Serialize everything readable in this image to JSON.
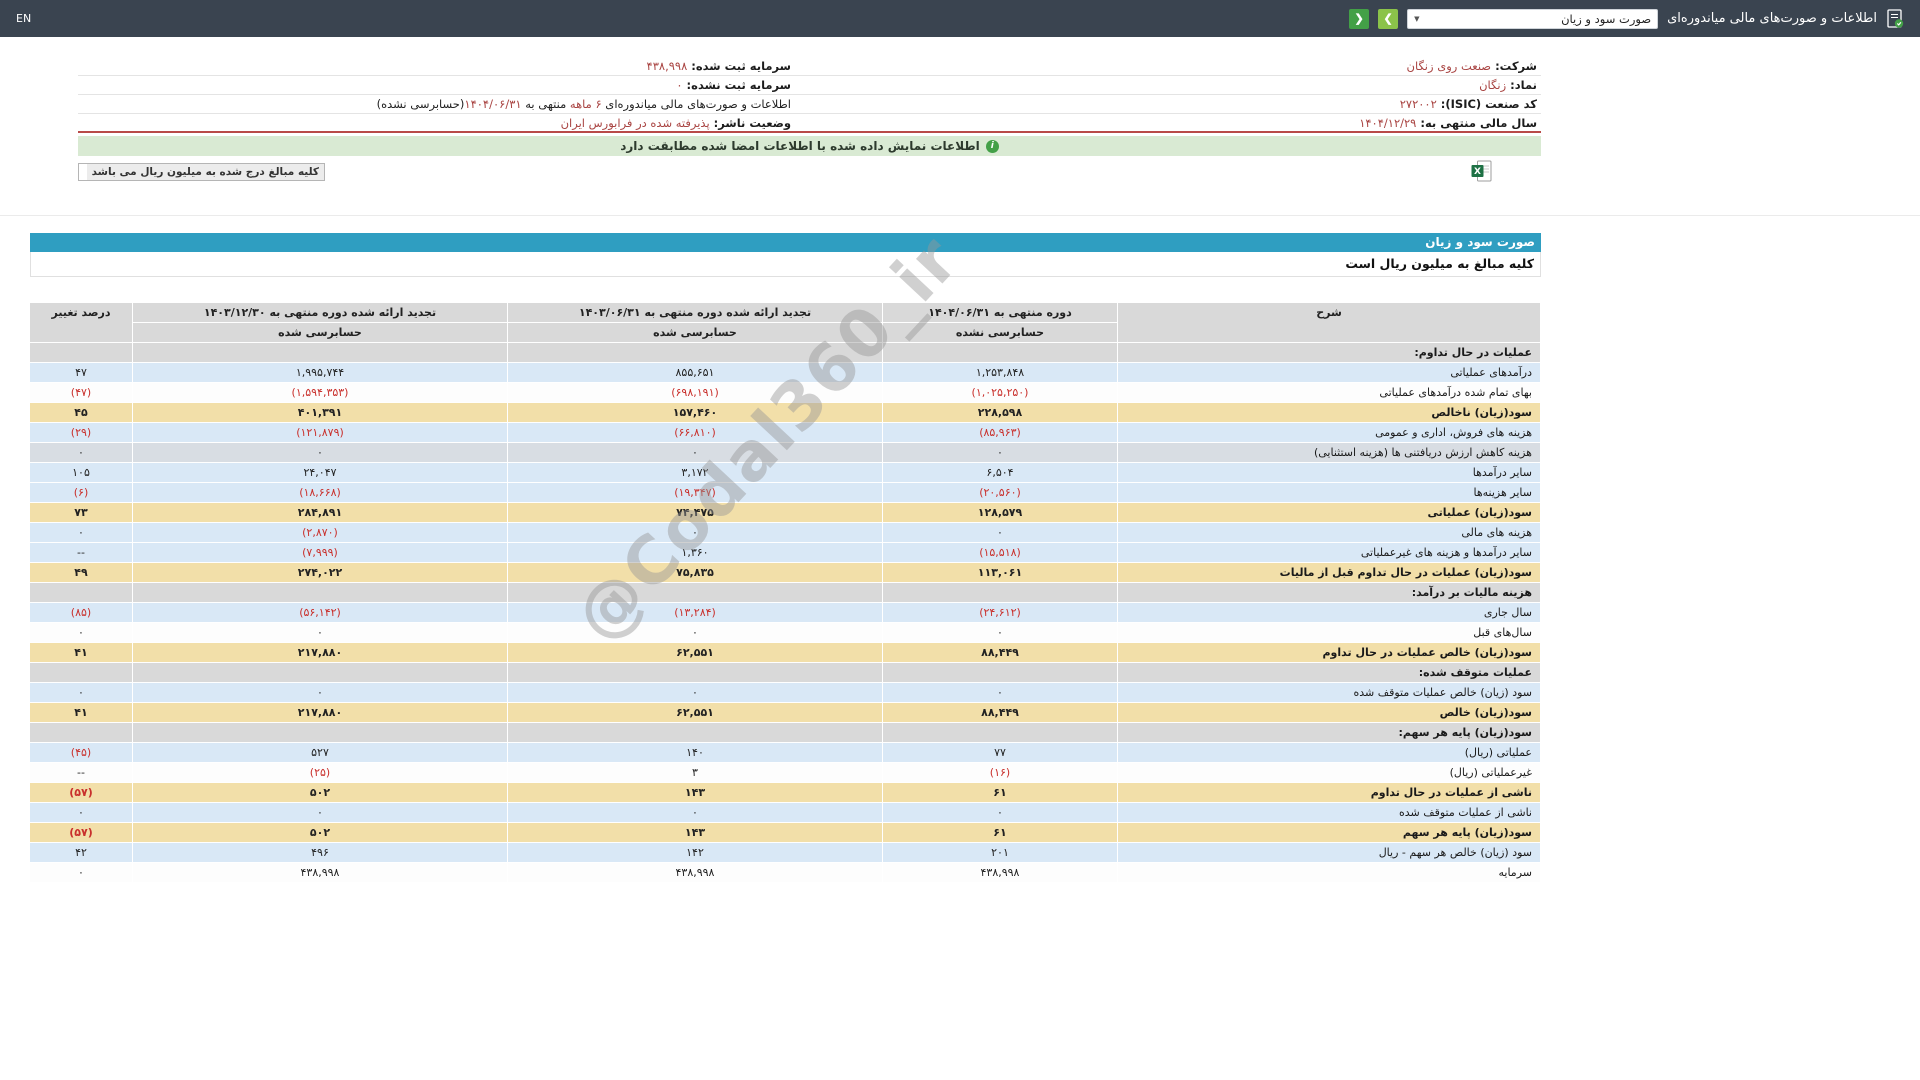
{
  "topbar": {
    "en_label": "EN",
    "title": "اطلاعات و صورت‌های مالی میاندوره‌ای",
    "report_select_value": "صورت سود و زیان"
  },
  "icons": {
    "chevron_down": "▼",
    "prev": "❮",
    "next": "❯"
  },
  "company": {
    "rows": [
      {
        "right": [
          {
            "t": "شرکت: ",
            "b": true
          },
          {
            "t": "صنعت روی زنگان",
            "red": true
          }
        ],
        "left": [
          {
            "t": "سرمایه ثبت شده: ",
            "b": true
          },
          {
            "t": "۴۳۸,۹۹۸",
            "red": true
          }
        ]
      },
      {
        "right": [
          {
            "t": "نماد: ",
            "b": true
          },
          {
            "t": "زنگان",
            "red": true
          }
        ],
        "left": [
          {
            "t": "سرمایه ثبت نشده: ",
            "b": true
          },
          {
            "t": "۰",
            "red": true
          }
        ]
      },
      {
        "right": [
          {
            "t": "کد صنعت (ISIC): ",
            "b": true
          },
          {
            "t": "۲۷۲۰۰۲",
            "red": true
          }
        ],
        "left": [
          {
            "t": "اطلاعات و صورت‌های مالی میاندوره‌ای "
          },
          {
            "t": "۶ ماهه",
            "red": true
          },
          {
            "t": " منتهی به "
          },
          {
            "t": "۱۴۰۴/۰۶/۳۱",
            "red": true
          },
          {
            "t": "(حسابرسی نشده)"
          }
        ]
      },
      {
        "right": [
          {
            "t": "سال مالی منتهی به: ",
            "b": true
          },
          {
            "t": "۱۴۰۴/۱۲/۲۹",
            "red": true
          }
        ],
        "left": [
          {
            "t": "وضعیت ناشر: ",
            "b": true
          },
          {
            "t": "پذیرفته شده در فرابورس ایران",
            "red": true
          }
        ]
      }
    ]
  },
  "banner": {
    "icon_glyph": "i",
    "text": "اطلاعات نمایش داده شده با اطلاعات امضا شده مطابقت دارد"
  },
  "note": {
    "text": "کلیه مبالغ درج شده به میلیون ریال می باشد"
  },
  "statement": {
    "title": "صورت سود و زیان",
    "unit_note": "کلیه مبالغ به میلیون ریال است",
    "columns": {
      "desc": "شرح",
      "col1": "دوره منتهی به ۱۴۰۴/۰۶/۳۱",
      "col1_sub": "حسابرسی نشده",
      "col2": "تجدید ارائه شده دوره منتهی به ۱۴۰۳/۰۶/۳۱",
      "col2_sub": "حسابرسی شده",
      "col3": "تجدید ارائه شده دوره منتهی به ۱۴۰۳/۱۲/۳۰",
      "col3_sub": "حسابرسی شده",
      "pct": "درصد تغییر"
    },
    "rows": [
      {
        "kind": "section",
        "label": "عملیات در حال تداوم:",
        "v1": "",
        "v2": "",
        "v3": "",
        "pct": ""
      },
      {
        "kind": "item",
        "label": "درآمدهای عملیاتی",
        "v1": "۱,۲۵۳,۸۴۸",
        "v2": "۸۵۵,۶۵۱",
        "v3": "۱,۹۹۵,۷۴۴",
        "pct": "۴۷"
      },
      {
        "kind": "item-alt",
        "label": "بهای تمام شده درآمدهای عملیاتی",
        "v1": "(۱,۰۲۵,۲۵۰)",
        "v2": "(۶۹۸,۱۹۱)",
        "v3": "(۱,۵۹۴,۳۵۳)",
        "pct": "(۴۷)"
      },
      {
        "kind": "total",
        "label": "سود(زیان) ناخالص",
        "v1": "۲۲۸,۵۹۸",
        "v2": "۱۵۷,۴۶۰",
        "v3": "۴۰۱,۳۹۱",
        "pct": "۴۵"
      },
      {
        "kind": "item",
        "label": "هزینه های فروش، اداری و عمومی",
        "v1": "(۸۵,۹۶۳)",
        "v2": "(۶۶,۸۱۰)",
        "v3": "(۱۲۱,۸۷۹)",
        "pct": "(۲۹)"
      },
      {
        "kind": "item-muted",
        "label": "هزینه کاهش ارزش دریافتنی ها (هزینه استثنایی)",
        "v1": "۰",
        "v2": "۰",
        "v3": "۰",
        "pct": "۰"
      },
      {
        "kind": "item",
        "label": "سایر درآمدها",
        "v1": "۶,۵۰۴",
        "v2": "۳,۱۷۲",
        "v3": "۲۴,۰۴۷",
        "pct": "۱۰۵"
      },
      {
        "kind": "item",
        "label": "سایر هزینه‌ها",
        "v1": "(۲۰,۵۶۰)",
        "v2": "(۱۹,۳۴۷)",
        "v3": "(۱۸,۶۶۸)",
        "pct": "(۶)"
      },
      {
        "kind": "total",
        "label": "سود(زیان) عملیاتی",
        "v1": "۱۲۸,۵۷۹",
        "v2": "۷۴,۴۷۵",
        "v3": "۲۸۴,۸۹۱",
        "pct": "۷۳"
      },
      {
        "kind": "item",
        "label": "هزینه های مالی",
        "v1": "۰",
        "v2": "۰",
        "v3": "(۲,۸۷۰)",
        "pct": "۰"
      },
      {
        "kind": "item",
        "label": "سایر درآمدها و هزینه های غیرعملیاتی",
        "v1": "(۱۵,۵۱۸)",
        "v2": "۱,۳۶۰",
        "v3": "(۷,۹۹۹)",
        "pct": "--"
      },
      {
        "kind": "total",
        "label": "سود(زیان) عملیات در حال تداوم قبل از مالیات",
        "v1": "۱۱۳,۰۶۱",
        "v2": "۷۵,۸۳۵",
        "v3": "۲۷۴,۰۲۲",
        "pct": "۴۹"
      },
      {
        "kind": "section",
        "label": "هزینه مالیات بر درآمد:",
        "v1": "",
        "v2": "",
        "v3": "",
        "pct": ""
      },
      {
        "kind": "item",
        "label": "سال جاری",
        "v1": "(۲۴,۶۱۲)",
        "v2": "(۱۳,۲۸۴)",
        "v3": "(۵۶,۱۴۲)",
        "pct": "(۸۵)"
      },
      {
        "kind": "item-alt",
        "label": "سال‌های قبل",
        "v1": "۰",
        "v2": "۰",
        "v3": "۰",
        "pct": "۰"
      },
      {
        "kind": "total",
        "label": "سود(زیان) خالص عملیات در حال تداوم",
        "v1": "۸۸,۴۴۹",
        "v2": "۶۲,۵۵۱",
        "v3": "۲۱۷,۸۸۰",
        "pct": "۴۱"
      },
      {
        "kind": "section",
        "label": "عملیات متوقف شده:",
        "v1": "",
        "v2": "",
        "v3": "",
        "pct": ""
      },
      {
        "kind": "item",
        "label": "سود (زیان) خالص عملیات متوقف شده",
        "v1": "۰",
        "v2": "۰",
        "v3": "۰",
        "pct": "۰"
      },
      {
        "kind": "total",
        "label": "سود(زیان) خالص",
        "v1": "۸۸,۴۴۹",
        "v2": "۶۲,۵۵۱",
        "v3": "۲۱۷,۸۸۰",
        "pct": "۴۱"
      },
      {
        "kind": "section",
        "label": "سود(زیان) پایه هر سهم:",
        "v1": "",
        "v2": "",
        "v3": "",
        "pct": ""
      },
      {
        "kind": "item",
        "label": "عملیاتی (ریال)",
        "v1": "۷۷",
        "v2": "۱۴۰",
        "v3": "۵۲۷",
        "pct": "(۴۵)"
      },
      {
        "kind": "item-alt",
        "label": "غیرعملیاتی (ریال)",
        "v1": "(۱۶)",
        "v2": "۳",
        "v3": "(۲۵)",
        "pct": "--"
      },
      {
        "kind": "total",
        "label": "ناشی از عملیات در حال تداوم",
        "v1": "۶۱",
        "v2": "۱۴۳",
        "v3": "۵۰۲",
        "pct": "(۵۷)"
      },
      {
        "kind": "item",
        "label": "ناشی از عملیات متوقف شده",
        "v1": "۰",
        "v2": "۰",
        "v3": "۰",
        "pct": "۰"
      },
      {
        "kind": "total",
        "label": "سود(زیان) پایه هر سهم",
        "v1": "۶۱",
        "v2": "۱۴۳",
        "v3": "۵۰۲",
        "pct": "(۵۷)"
      },
      {
        "kind": "item",
        "label": "سود (زیان) خالص هر سهم - ریال",
        "v1": "۲۰۱",
        "v2": "۱۴۲",
        "v3": "۴۹۶",
        "pct": "۴۲"
      },
      {
        "kind": "item-alt",
        "label": "سرمایه",
        "v1": "۴۳۸,۹۹۸",
        "v2": "۴۳۸,۹۹۸",
        "v3": "۴۳۸,۹۹۸",
        "pct": "۰"
      }
    ]
  },
  "watermark": {
    "text": "@Codal360_ir"
  },
  "colors": {
    "topbar_bg": "#3a4450",
    "accent_teal": "#2f9ec1",
    "row_blue": "#d9e8f6",
    "row_yellow": "#f2dfa9",
    "row_gray": "#d9d9d9",
    "row_muted": "#d8dde3",
    "negative_red": "#c9302c",
    "value_red": "#a94442",
    "banner_green_bg": "#d9ead3",
    "button_green": "#43a047",
    "button_green_light": "#8bc34a"
  }
}
